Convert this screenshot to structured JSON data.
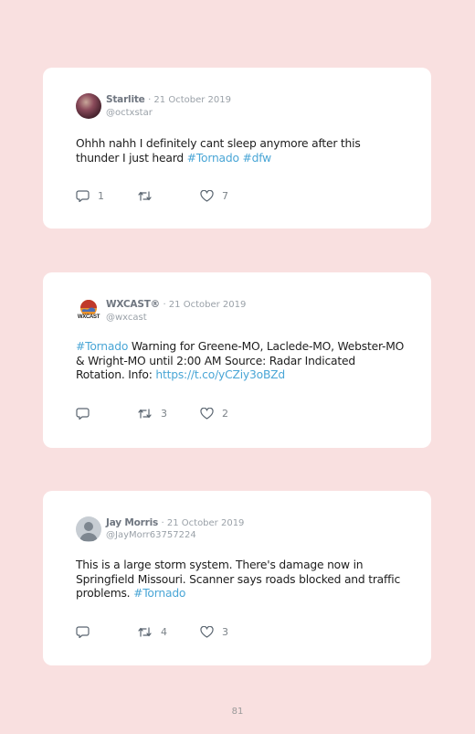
{
  "tweets": [
    {
      "name": "Starlite",
      "date": "· 21 October 2019",
      "handle": "@octxstar",
      "text_parts": [
        "Ohhh nahh I definitely cant sleep anymore after this thunder I just heard ",
        "#Tornado",
        " ",
        "#dfw"
      ],
      "replies": "1",
      "retweets": "",
      "likes": "7",
      "avatar": "user-photo"
    },
    {
      "name": "WXCAST®",
      "date": "· 21 October 2019",
      "handle": "@wxcast",
      "text_parts": [
        "#Tornado",
        " Warning for Greene-MO, Laclede-MO, Webster-MO & Wright-MO until 2:00 AM Source: Radar Indicated Rotation. Info: ",
        "https://t.co/yCZiy3oBZd"
      ],
      "replies": "",
      "retweets": "3",
      "likes": "2",
      "avatar": "wxcast-logo",
      "avatar_text": "WXCAST"
    },
    {
      "name": "Jay Morris",
      "date": "· 21 October 2019",
      "handle": "@JayMorr63757224",
      "text_parts": [
        "This is a large storm system. There's damage now in Springfield Missouri. Scanner says roads blocked and traffic problems. ",
        "#Tornado"
      ],
      "replies": "",
      "retweets": "4",
      "likes": "3",
      "avatar": "default-avatar"
    }
  ],
  "page_number": "81",
  "colors": {
    "background": "#f9e0e0",
    "card": "#ffffff",
    "hashtag": "#4aa6d6",
    "icon": "#5a6570"
  },
  "icons": [
    "reply-icon",
    "retweet-icon",
    "heart-icon"
  ]
}
